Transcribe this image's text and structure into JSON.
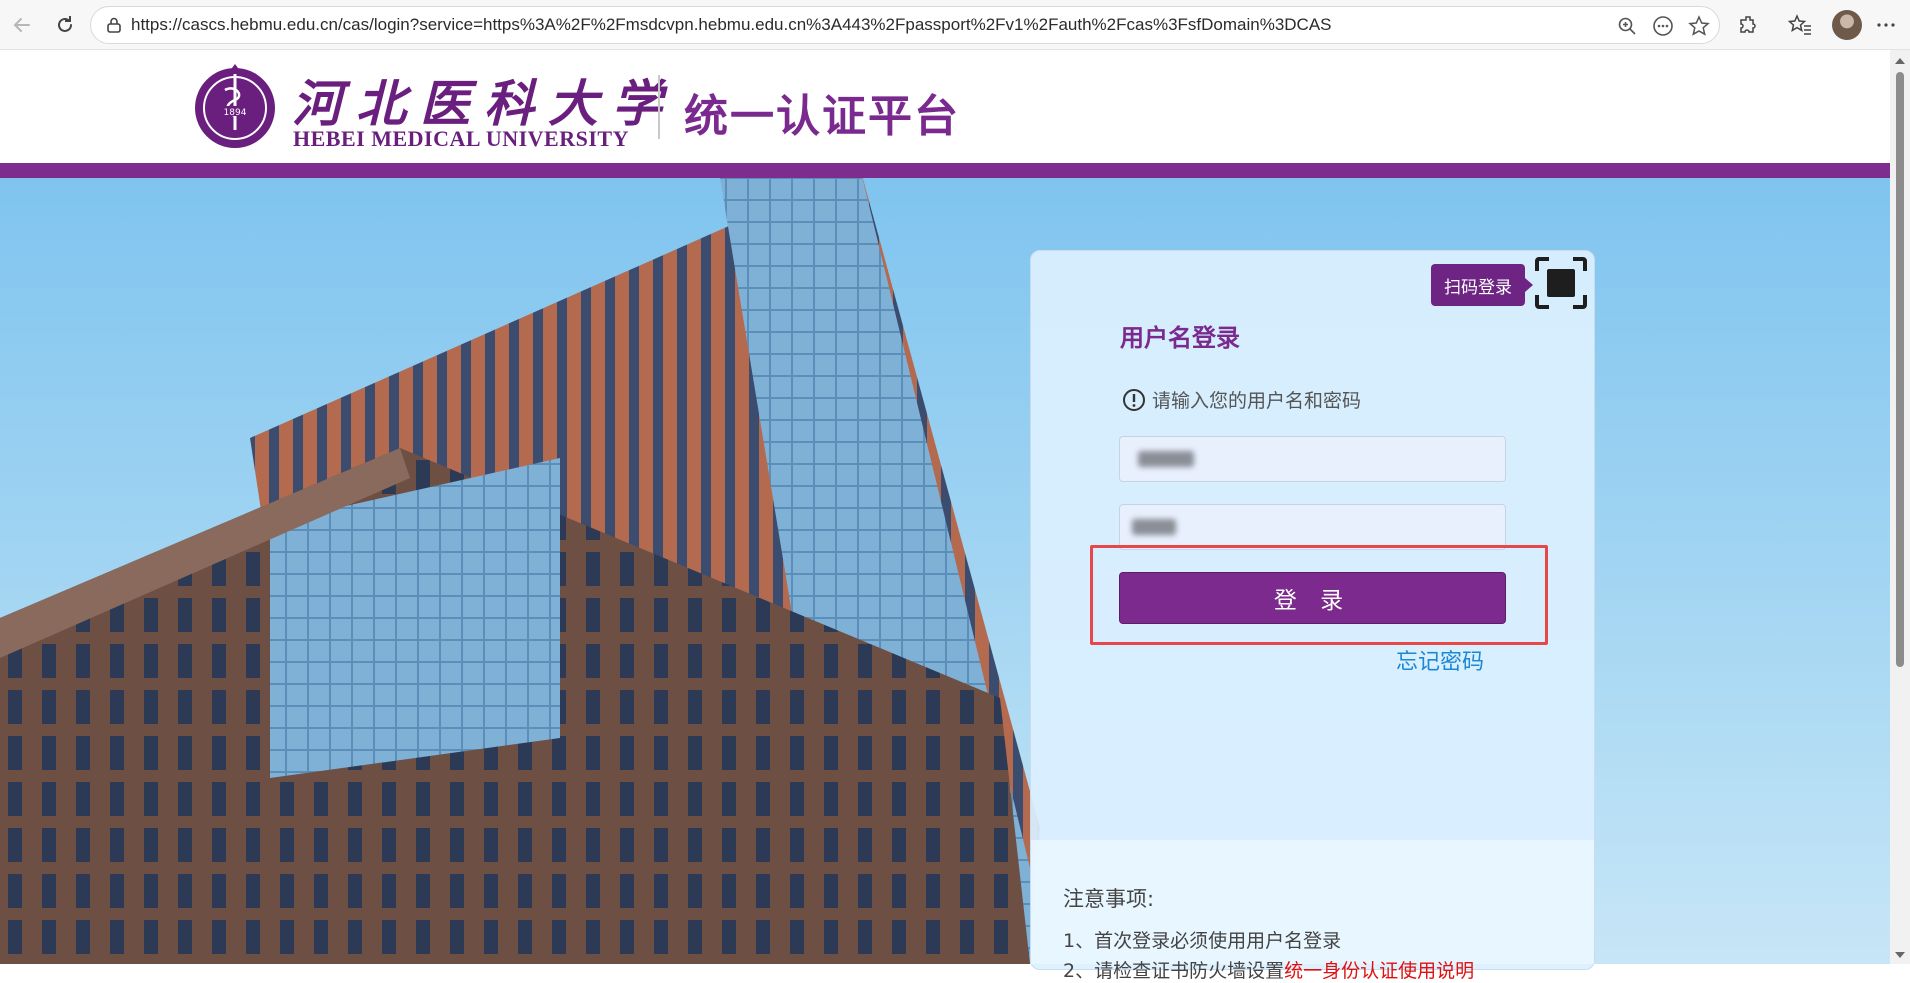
{
  "browser": {
    "url": "https://cascs.hebmu.edu.cn/cas/login?service=https%3A%2F%2Fmsdcvpn.hebmu.edu.cn%3A443%2Fpassport%2Fv1%2Fauth%2Fcas%3FsfDomain%3DCAS",
    "icons": [
      "back-arrow-icon",
      "reload-icon",
      "lock-icon",
      "zoom-icon",
      "more-dots-icon",
      "star-icon",
      "extensions-icon",
      "favorites-icon",
      "avatar",
      "menu-dots-icon"
    ]
  },
  "header": {
    "logo_cn": "河北医科大学",
    "logo_en": "HEBEI MEDICAL UNIVERSITY",
    "emblem_year": "1894",
    "platform_title": "统一认证平台"
  },
  "login": {
    "qr_tag": "扫码登录",
    "title": "用户名登录",
    "hint": "请输入您的用户名和密码",
    "button": "登 录",
    "forgot": "忘记密码"
  },
  "notice": {
    "title": "注意事项:",
    "item1": "1、首次登录必须使用用户名登录",
    "item2_prefix": "2、请检查证书防火墙设置",
    "item2_link": "统一身份认证使用说明"
  },
  "colors": {
    "brand_purple": "#7d2d8e",
    "link_blue": "#1e87d4",
    "highlight_red": "#e8474a"
  }
}
